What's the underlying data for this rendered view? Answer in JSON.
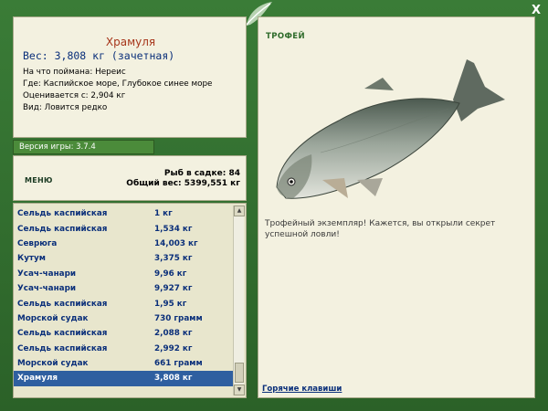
{
  "window": {
    "close_label": "X"
  },
  "fish_info": {
    "title": "Храмуля",
    "weight": "Вес: 3,808 кг (зачетная)",
    "lines": [
      "На что поймана: Нереис",
      "Где: Каспийское море, Глубокое синее море",
      "Оценивается с: 2,904 кг",
      "Вид: Ловится редко"
    ]
  },
  "version": "Версия игры: 3.7.4",
  "menu": {
    "label": "МЕНЮ"
  },
  "stats": {
    "count": "Рыб в садке: 84",
    "total_weight": "Общий вес: 5399,551 кг"
  },
  "catch_list": [
    {
      "name": "Сельдь каспийская",
      "weight": "1 кг"
    },
    {
      "name": "Сельдь каспийская",
      "weight": "1,534 кг"
    },
    {
      "name": "Севрюга",
      "weight": "14,003 кг"
    },
    {
      "name": "Кутум",
      "weight": "3,375 кг"
    },
    {
      "name": "Усач-чанари",
      "weight": "9,96 кг"
    },
    {
      "name": "Усач-чанари",
      "weight": "9,927 кг"
    },
    {
      "name": "Сельдь каспийская",
      "weight": "1,95 кг"
    },
    {
      "name": "Морской судак",
      "weight": "730 грамм"
    },
    {
      "name": "Сельдь каспийская",
      "weight": "2,088 кг"
    },
    {
      "name": "Сельдь каспийская",
      "weight": "2,992 кг"
    },
    {
      "name": "Морской судак",
      "weight": "661 грамм"
    },
    {
      "name": "Храмуля",
      "weight": "3,808 кг",
      "selected": true
    }
  ],
  "trophy": {
    "label": "ТРОФЕЙ",
    "text": "Трофейный экземпляр! Кажется, вы открыли секрет успешной ловли!"
  },
  "hotkeys": "Горячие клавиши",
  "icons": {
    "close": "close-icon",
    "logo": "leaf-logo-icon",
    "scroll_up": "arrow-up-icon",
    "scroll_down": "arrow-down-icon"
  },
  "colors": {
    "frame": "#2f6a2c",
    "panel": "#f3f1e0",
    "title": "#a6351a",
    "link": "#0a2f7a",
    "selected": "#2f5fa0"
  }
}
